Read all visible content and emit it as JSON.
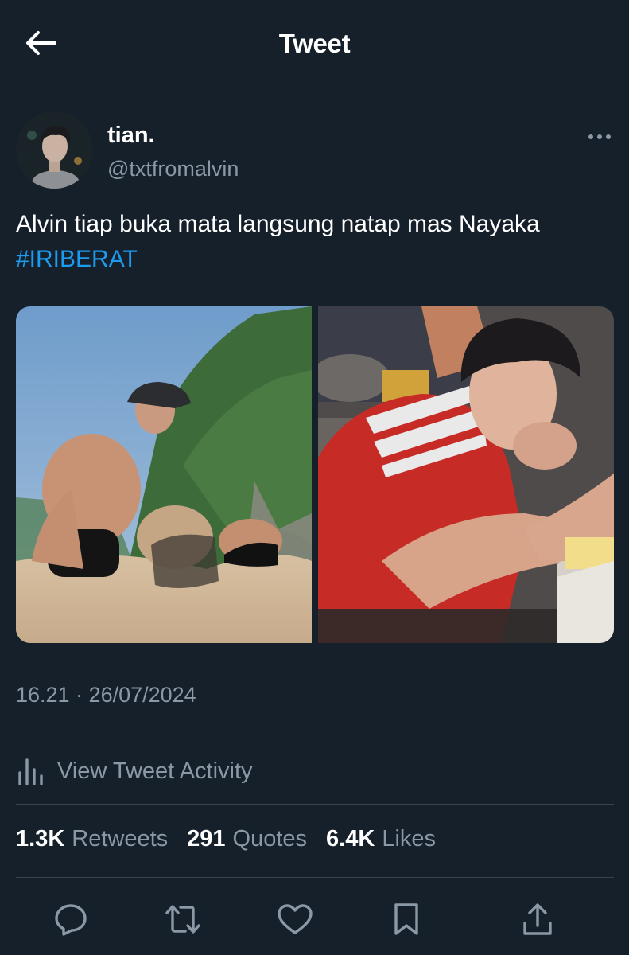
{
  "header": {
    "title": "Tweet",
    "back_icon": "arrow-left-icon"
  },
  "author": {
    "display_name": "tian.",
    "handle": "@txtfromalvin",
    "more_icon": "more-horizontal-icon"
  },
  "tweet": {
    "text": "Alvin tiap buka mata langsung natap mas Nayaka",
    "hashtag": "#IRIBERAT",
    "timestamp": "16.21 · 26/07/2024"
  },
  "activity": {
    "label": "View Tweet Activity",
    "icon": "bar-chart-icon"
  },
  "stats": {
    "retweets_count": "1.3K",
    "retweets_label": "Retweets",
    "quotes_count": "291",
    "quotes_label": "Quotes",
    "likes_count": "6.4K",
    "likes_label": "Likes"
  },
  "actions": {
    "reply_icon": "reply-icon",
    "retweet_icon": "retweet-icon",
    "like_icon": "heart-icon",
    "bookmark_icon": "bookmark-icon",
    "share_icon": "share-icon"
  },
  "colors": {
    "background": "#15202b",
    "secondary_text": "#8b98a5",
    "link": "#1d9bf0",
    "divider": "#38444d"
  }
}
